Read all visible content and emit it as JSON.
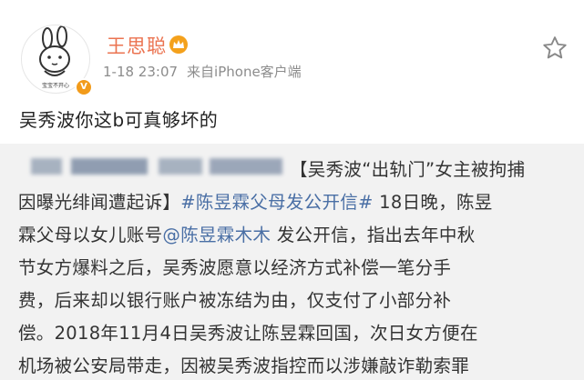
{
  "post": {
    "author": "王思聪",
    "time": "1-18 23:07",
    "source": "来自iPhone客户端",
    "text": "吴秀波你这b可真够坏的",
    "avatar_caption": "宝宝不开心"
  },
  "repost": {
    "line1_text": "【吴秀波“出轨门”女主被拘捕",
    "line2_a": "因曝光绯闻遭起诉】",
    "line2_tag": "#陈昱霖父母发公开信#",
    "line2_b": " 18日晚，陈昱",
    "line3_a": "霖父母以女儿账号",
    "line3_mention": "@陈昱霖木木",
    "line3_b": " 发公开信，指出去年中秋",
    "line4": "节女方爆料之后，吴秀波愿意以经济方式补偿一笔分手",
    "line5": "费，后来却以银行账户被冻结为由，仅支付了小部分补",
    "line6": "偿。2018年11月4日吴秀波让陈昱霖回国，次日女方便在",
    "line7": "机场被公安局带走，因被吴秀波指控而以涉嫌敲诈勒索罪"
  },
  "colors": {
    "name": "#eb7350",
    "link": "#4a6fa5",
    "repost_bg": "#f2f2f2"
  },
  "icons": {
    "favorite": "star-outline-icon",
    "verified": "orange-v-badge-icon",
    "member": "crown-badge-icon"
  }
}
